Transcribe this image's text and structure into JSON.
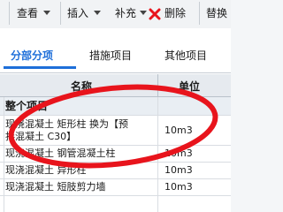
{
  "toolbar": {
    "items": [
      {
        "label": "查看"
      },
      {
        "label": "插入"
      },
      {
        "label": "补充"
      },
      {
        "label": "删除"
      },
      {
        "label": "替换"
      }
    ]
  },
  "tabs": [
    {
      "label": "分部分项",
      "active": true
    },
    {
      "label": "措施项目",
      "active": false
    },
    {
      "label": "其他项目",
      "active": false
    }
  ],
  "grid": {
    "headers": {
      "name": "名称",
      "unit": "单位"
    },
    "section": "整个项目",
    "rows": [
      {
        "name_line1": "现浇混凝土 矩形柱  换为【预",
        "name_line2": "拌混凝土 C30】",
        "unit": "10m3"
      },
      {
        "name_line1": "现浇混凝土 钢管混凝土柱",
        "unit": "10m3"
      },
      {
        "name_line1": "现浇混凝土 异形柱",
        "unit": "10m3"
      },
      {
        "name_line1": "现浇混凝土 短肢剪力墙",
        "unit": "10m3"
      }
    ]
  },
  "colors": {
    "accent": "#1e6fd9",
    "annotation": "#e8141c",
    "delete": "#e8141c"
  }
}
